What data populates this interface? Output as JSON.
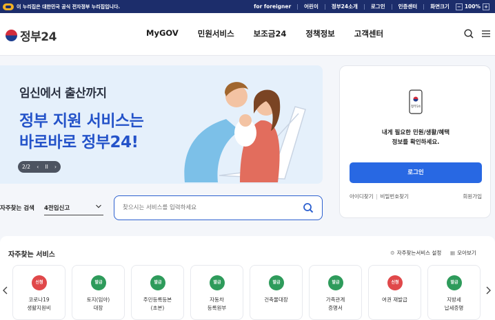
{
  "gov_bar": {
    "notice": "이 누리집은 대한민국 공식 전자정부 누리집입니다.",
    "links": [
      "for foreigner",
      "어린이",
      "정부24소개",
      "로그인",
      "인증센터",
      "화면크기"
    ],
    "zoom_minus": "−",
    "zoom_value": "100%",
    "zoom_plus": "+"
  },
  "header": {
    "logo_text": "정부24",
    "nav": [
      "MyGOV",
      "민원서비스",
      "보조금24",
      "정책정보",
      "고객센터"
    ]
  },
  "hero": {
    "subtitle": "임신에서 출산까지",
    "title_line1": "정부 지원 서비스는",
    "title_line2": "바로바로 정부24!",
    "page_indicator": "2/2",
    "pause": "II"
  },
  "login_card": {
    "phone_caption": "정부24",
    "message_line1": "내게 필요한 민원/생활/혜택",
    "message_line2": "정보를 확인하세요.",
    "login_button": "로그인",
    "find_id": "아이디찾기",
    "find_pw": "비밀번호찾기",
    "join": "회원가입"
  },
  "search": {
    "fav_label": "자주찾는 검색",
    "fav_selected": "4전입신고",
    "placeholder": "찾으시는 서비스를 입력하세요"
  },
  "services": {
    "title": "자주찾는 서비스",
    "setting_label": "자주찾는서비스 설정",
    "view_all_label": "모아보기",
    "items": [
      {
        "badge": "신청",
        "name": "코로나19\n생활지원비",
        "badge_color": "#e0484a"
      },
      {
        "badge": "발급",
        "name": "토지(임야)\n대장",
        "badge_color": "#2e9b5b"
      },
      {
        "badge": "발급",
        "name": "주민등록등본\n(초본)",
        "badge_color": "#2e9b5b"
      },
      {
        "badge": "발급",
        "name": "자동차\n등록원부",
        "badge_color": "#2e9b5b"
      },
      {
        "badge": "발급",
        "name": "건축물대장",
        "badge_color": "#2e9b5b"
      },
      {
        "badge": "발급",
        "name": "가족관계\n증명서",
        "badge_color": "#2e9b5b"
      },
      {
        "badge": "신청",
        "name": "여권 재발급",
        "badge_color": "#e0484a"
      },
      {
        "badge": "발급",
        "name": "지방세\n납세증명",
        "badge_color": "#2e9b5b"
      }
    ]
  }
}
